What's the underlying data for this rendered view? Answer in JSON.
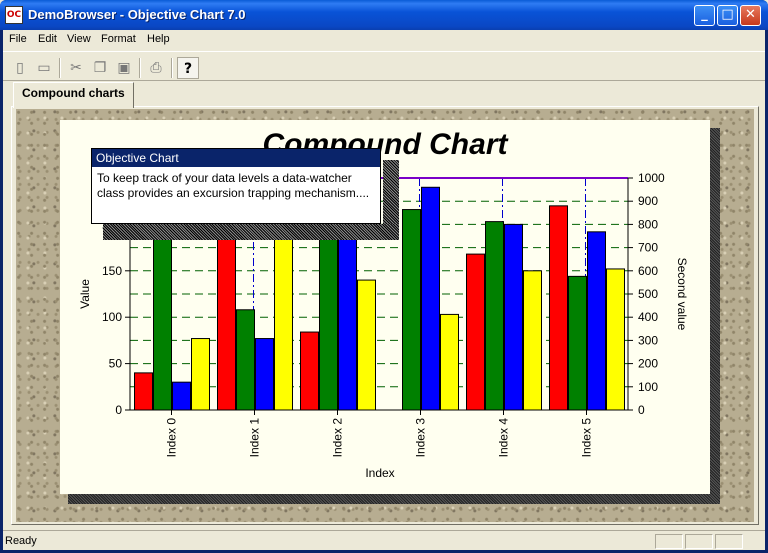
{
  "window": {
    "title": "DemoBrowser - Objective Chart 7.0",
    "app_icon_text": "OC"
  },
  "titlebar_buttons": {
    "minimize": "_",
    "maximize": "□",
    "close": "✕"
  },
  "menu": [
    "File",
    "Edit",
    "View",
    "Format",
    "Help"
  ],
  "toolbar": {
    "icons": [
      "new-file-icon",
      "open-folder-icon",
      "cut-icon",
      "copy-icon",
      "paste-icon",
      "print-icon",
      "help-icon"
    ],
    "glyphs": [
      "▯",
      "▭",
      "✂",
      "❐",
      "▣",
      "⎙",
      "?"
    ]
  },
  "tabs": [
    {
      "label": "Compound charts"
    }
  ],
  "chart": {
    "title": "Compound Chart"
  },
  "tooltip": {
    "title": "Objective Chart",
    "body": "To keep track of your data levels a data-watcher class provides an excursion trapping mechanism...."
  },
  "colors": {
    "red": "#ff0000",
    "green": "#008000",
    "blue": "#0000ff",
    "yellow": "#ffff00",
    "threshold": "#7a00c8",
    "grid": "#006000"
  },
  "chart_data": {
    "type": "bar",
    "categories": [
      "Index 0",
      "Index 1",
      "Index 2",
      "Index 3",
      "Index 4",
      "Index 5"
    ],
    "series": [
      {
        "color": "#ff0000",
        "values": [
          40,
          210,
          84,
          0,
          168,
          220
        ]
      },
      {
        "color": "#008000",
        "values": [
          235,
          108,
          214,
          216,
          203,
          144
        ]
      },
      {
        "color": "#0000ff",
        "values": [
          30,
          77,
          210,
          240,
          200,
          192
        ]
      },
      {
        "color": "#ffff00",
        "values": [
          77,
          185,
          140,
          103,
          150,
          152
        ]
      }
    ],
    "title": "Compound Chart",
    "xlabel": "Index",
    "ylabel": "Value",
    "y2label": "Second value",
    "ylim": [
      0,
      250
    ],
    "y2lim": [
      0,
      1000
    ],
    "yticks": [
      0,
      50,
      100,
      150,
      200
    ],
    "y2ticks": [
      0,
      100,
      200,
      300,
      400,
      500,
      600,
      700,
      800,
      900,
      1000
    ],
    "threshold_line": 1000,
    "grid": true
  },
  "status": {
    "text": "Ready"
  }
}
